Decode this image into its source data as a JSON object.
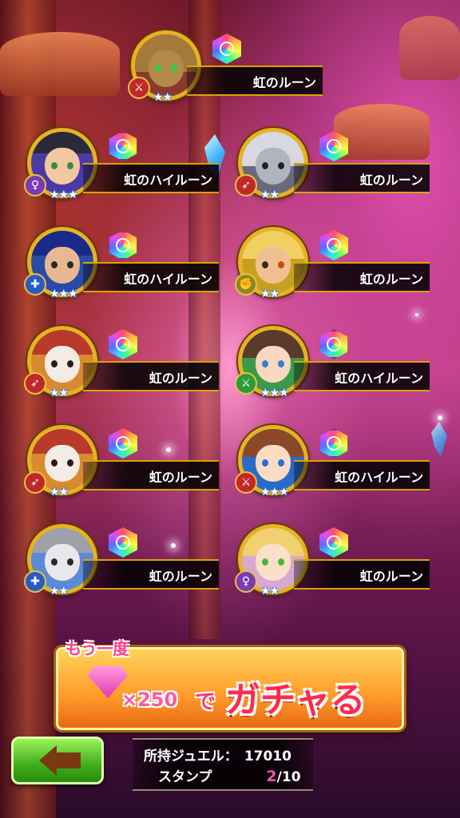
{
  "results": [
    {
      "name": "虹のルーン",
      "stars": "★★",
      "rune": "normal"
    },
    {
      "name": "虹のハイルーン",
      "stars": "★★★",
      "rune": "high"
    },
    {
      "name": "虹のルーン",
      "stars": "★★",
      "rune": "normal"
    },
    {
      "name": "虹のハイルーン",
      "stars": "★★★",
      "rune": "high"
    },
    {
      "name": "虹のルーン",
      "stars": "★★",
      "rune": "normal"
    },
    {
      "name": "虹のルーン",
      "stars": "★★",
      "rune": "normal"
    },
    {
      "name": "虹のハイルーン",
      "stars": "★★★",
      "rune": "high"
    },
    {
      "name": "虹のルーン",
      "stars": "★★",
      "rune": "normal"
    },
    {
      "name": "虹のハイルーン",
      "stars": "★★★",
      "rune": "high"
    },
    {
      "name": "虹のルーン",
      "stars": "★★",
      "rune": "normal"
    },
    {
      "name": "虹のルーン",
      "stars": "★★",
      "rune": "normal"
    }
  ],
  "gacha_button": {
    "again_label": "もう一度",
    "cost_label": "×250",
    "de_label": "で",
    "action_label": "ガチャる"
  },
  "status": {
    "jewel_label": "所持ジュエル：",
    "jewel_value": "17010",
    "stamp_label": "スタンプ",
    "stamp_current": "2",
    "stamp_total": "/10"
  },
  "icons": {
    "back": "left-arrow-icon",
    "gem": "gem-icon"
  },
  "colors": {
    "gacha_button": "#ff9a2a",
    "back_button": "#3fae1a",
    "stamp_current": "#ff4fb0"
  }
}
